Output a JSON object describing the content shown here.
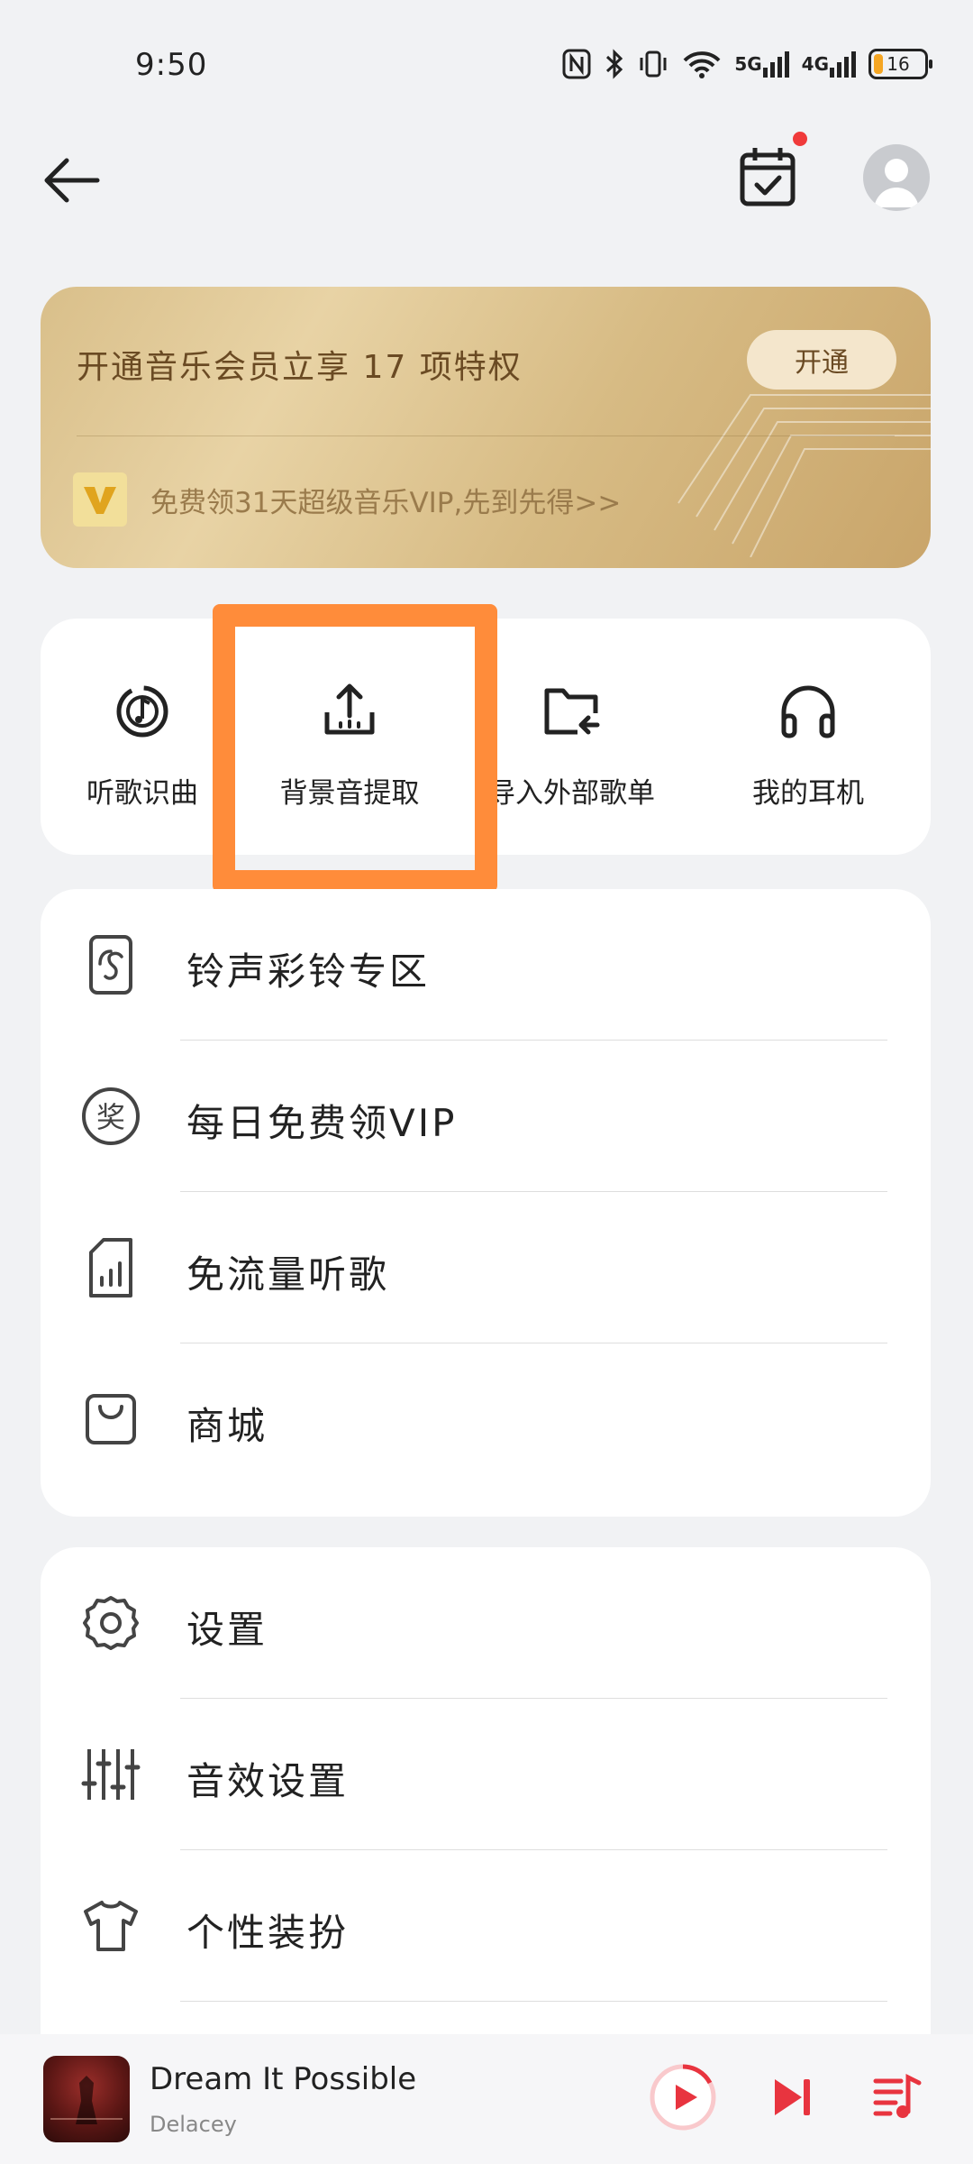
{
  "status_bar": {
    "time": "9:50",
    "signal_5g": "5G",
    "signal_4g": "4G",
    "battery": "16"
  },
  "colors": {
    "accent": "#f03a3a",
    "highlight": "#ff8c3a",
    "vip_text": "#6a4a23"
  },
  "vip": {
    "title": "开通音乐会员立享 17 项特权",
    "button": "开通",
    "promo": "免费领31天超级音乐VIP,先到先得>>"
  },
  "quick_actions": [
    {
      "label": "听歌识曲",
      "icon": "music-recognition-icon"
    },
    {
      "label": "背景音提取",
      "icon": "upload-icon"
    },
    {
      "label": "导入外部歌单",
      "icon": "import-folder-icon"
    },
    {
      "label": "我的耳机",
      "icon": "headphones-icon"
    }
  ],
  "menu_group_1": [
    {
      "label": "铃声彩铃专区",
      "icon": "ringtone-icon"
    },
    {
      "label": "每日免费领VIP",
      "icon": "award-icon"
    },
    {
      "label": "免流量听歌",
      "icon": "sim-card-icon"
    },
    {
      "label": "商城",
      "icon": "shopping-bag-icon"
    }
  ],
  "menu_group_2": [
    {
      "label": "设置",
      "icon": "gear-icon"
    },
    {
      "label": "音效设置",
      "icon": "equalizer-icon"
    },
    {
      "label": "个性装扮",
      "icon": "tshirt-icon"
    }
  ],
  "player": {
    "song": "Dream It Possible",
    "artist": "Delacey"
  }
}
